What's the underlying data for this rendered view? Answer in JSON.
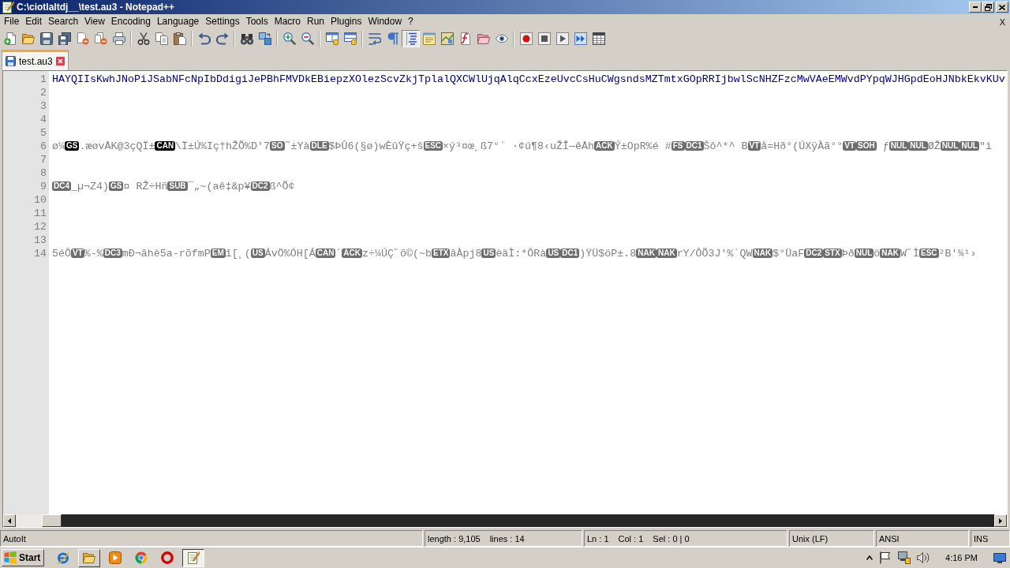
{
  "window": {
    "title": "C:\\ciotlaltdj__\\test.au3 - Notepad++"
  },
  "menu": {
    "items": [
      "File",
      "Edit",
      "Search",
      "View",
      "Encoding",
      "Language",
      "Settings",
      "Tools",
      "Macro",
      "Run",
      "Plugins",
      "Window",
      "?"
    ],
    "close_document": "X"
  },
  "toolbar": {
    "groups": [
      {
        "buttons": [
          {
            "kind": "new",
            "pressed": false
          },
          {
            "kind": "open",
            "pressed": false
          },
          {
            "kind": "save",
            "pressed": false
          },
          {
            "kind": "saveall",
            "pressed": false
          },
          {
            "kind": "close",
            "pressed": false
          },
          {
            "kind": "closeall",
            "pressed": false
          },
          {
            "kind": "print",
            "pressed": false
          }
        ]
      },
      {
        "buttons": [
          {
            "kind": "cut",
            "pressed": false
          },
          {
            "kind": "copy",
            "pressed": false
          },
          {
            "kind": "paste",
            "pressed": false
          }
        ]
      },
      {
        "buttons": [
          {
            "kind": "undo",
            "pressed": false
          },
          {
            "kind": "redo",
            "pressed": false
          }
        ]
      },
      {
        "buttons": [
          {
            "kind": "find",
            "pressed": false
          },
          {
            "kind": "replace",
            "pressed": false
          }
        ]
      },
      {
        "buttons": [
          {
            "kind": "zoomin",
            "pressed": false
          },
          {
            "kind": "zoomout",
            "pressed": false
          }
        ]
      },
      {
        "buttons": [
          {
            "kind": "syncv",
            "pressed": false
          },
          {
            "kind": "synch",
            "pressed": false
          }
        ]
      },
      {
        "buttons": [
          {
            "kind": "wrap",
            "pressed": false
          },
          {
            "kind": "pilcrow",
            "pressed": false
          },
          {
            "kind": "indent",
            "pressed": true
          },
          {
            "kind": "udl",
            "pressed": false
          },
          {
            "kind": "map",
            "pressed": false
          },
          {
            "kind": "functions",
            "pressed": false
          },
          {
            "kind": "workspace",
            "pressed": false
          },
          {
            "kind": "monitor",
            "pressed": false
          }
        ]
      },
      {
        "buttons": [
          {
            "kind": "record",
            "pressed": false
          },
          {
            "kind": "stop",
            "pressed": false
          },
          {
            "kind": "play",
            "pressed": false
          },
          {
            "kind": "repeat",
            "pressed": false
          },
          {
            "kind": "macros",
            "pressed": false
          }
        ]
      }
    ]
  },
  "tabs": [
    {
      "label": "test.au3",
      "selected": true
    }
  ],
  "editor": {
    "lines": [
      {
        "number": "1",
        "color": "#000080",
        "segments": [
          {
            "kind": "text",
            "text": "HAYQIIsKwhJNoPiJSabNFcNpIbDdigiJePBhFMVDkEBiepzXOlezScvZkjTplalQXCWlUjqAlqCcxEzeUvcCsHuCWgsndsMZTmtxGOpRRIjbwlScNHZFzcMwVAeEMWvdPYpqWJHGpdEoHJNbkEkvKUv"
          }
        ]
      },
      {
        "number": "2"
      },
      {
        "number": "3"
      },
      {
        "number": "4"
      },
      {
        "number": "5"
      },
      {
        "number": "6",
        "color": "#808080",
        "segments": [
          {
            "kind": "text",
            "text": "ø¼"
          },
          {
            "kind": "control",
            "text": "GS",
            "color": "#000000"
          },
          {
            "kind": "text",
            "text": ".æøvÅK@3çQÏ±"
          },
          {
            "kind": "control",
            "text": "CAN",
            "color": "#000000"
          },
          {
            "kind": "text",
            "text": "\\Ï±Ú%Iç†hŽÕ%D'7"
          },
          {
            "kind": "control",
            "text": "SO",
            "color": "#6e6e6e"
          },
          {
            "kind": "text",
            "text": "˜±Yà"
          },
          {
            "kind": "control",
            "text": "DLE",
            "color": "#6e6e6e"
          },
          {
            "kind": "text",
            "text": "$ÞÛ6(§ø)wÈûŸç+š"
          },
          {
            "kind": "control",
            "text": "ESC",
            "color": "#6e6e6e"
          },
          {
            "kind": "text",
            "text": "×ý³¤œ¸ß7°` ·¢ú¶8‹uŽÎ—êÅh"
          },
          {
            "kind": "control",
            "text": "ACK",
            "color": "#6e6e6e"
          },
          {
            "kind": "text",
            "text": "Ý±OpR%é #"
          },
          {
            "kind": "control",
            "text": "FS",
            "color": "#6e6e6e"
          },
          {
            "kind": "control",
            "text": "DC1",
            "color": "#6e6e6e"
          },
          {
            "kind": "text",
            "text": "Šô^*^ B"
          },
          {
            "kind": "control",
            "text": "VT",
            "color": "#6e6e6e"
          },
          {
            "kind": "text",
            "text": "å=Hð°(ÚXÿÀã°°"
          },
          {
            "kind": "control",
            "text": "VT",
            "color": "#6e6e6e"
          },
          {
            "kind": "control",
            "text": "SOH",
            "color": "#6e6e6e"
          },
          {
            "kind": "text",
            "text": " ƒ"
          },
          {
            "kind": "control",
            "text": "NUL",
            "color": "#6e6e6e"
          },
          {
            "kind": "control",
            "text": "NUL",
            "color": "#6e6e6e"
          },
          {
            "kind": "text",
            "text": "ØŽ"
          },
          {
            "kind": "control",
            "text": "NUL",
            "color": "#6e6e6e"
          },
          {
            "kind": "control",
            "text": "NUL",
            "color": "#6e6e6e"
          },
          {
            "kind": "text",
            "text": "\"ì"
          }
        ]
      },
      {
        "number": "7"
      },
      {
        "number": "8"
      },
      {
        "number": "9",
        "color": "#808080",
        "segments": [
          {
            "kind": "control",
            "text": "DC4",
            "color": "#6e6e6e"
          },
          {
            "kind": "text",
            "text": "_µ¬Z4)"
          },
          {
            "kind": "control",
            "text": "GS",
            "color": "#6e6e6e"
          },
          {
            "kind": "text",
            "text": "¤ RŽ÷Hñ"
          },
          {
            "kind": "control",
            "text": "SUB",
            "color": "#6e6e6e"
          },
          {
            "kind": "text",
            "text": "¯„~(aê‡&p¥"
          },
          {
            "kind": "control",
            "text": "DC2",
            "color": "#6e6e6e"
          },
          {
            "kind": "text",
            "text": "ß^Õ¢"
          }
        ]
      },
      {
        "number": "10"
      },
      {
        "number": "11"
      },
      {
        "number": "12"
      },
      {
        "number": "13"
      },
      {
        "number": "14",
        "color": "#808080",
        "segments": [
          {
            "kind": "text",
            "text": "5éÔ"
          },
          {
            "kind": "control",
            "text": "VT",
            "color": "#6e6e6e"
          },
          {
            "kind": "text",
            "text": "%-%"
          },
          {
            "kind": "control",
            "text": "DC3",
            "color": "#6e6e6e"
          },
          {
            "kind": "text",
            "text": "mÐ¬ãhè5a-rõfmP"
          },
          {
            "kind": "control",
            "text": "EM",
            "color": "#6e6e6e"
          },
          {
            "kind": "text",
            "text": "î[¸("
          },
          {
            "kind": "control",
            "text": "US",
            "color": "#6e6e6e"
          },
          {
            "kind": "text",
            "text": "ÁvÖ%ÓH[Á"
          },
          {
            "kind": "control",
            "text": "CAN",
            "color": "#6e6e6e"
          },
          {
            "kind": "text",
            "text": "´"
          },
          {
            "kind": "control",
            "text": "ACK",
            "color": "#6e6e6e"
          },
          {
            "kind": "text",
            "text": "z÷¼ÚÇ˝õ©(~b"
          },
          {
            "kind": "control",
            "text": "ETX",
            "color": "#6e6e6e"
          },
          {
            "kind": "text",
            "text": "âÀpj8"
          },
          {
            "kind": "control",
            "text": "US",
            "color": "#6e6e6e"
          },
          {
            "kind": "text",
            "text": "èäÌ:*ÔRà"
          },
          {
            "kind": "control",
            "text": "US",
            "color": "#6e6e6e"
          },
          {
            "kind": "control",
            "text": "DC1",
            "color": "#6e6e6e"
          },
          {
            "kind": "text",
            "text": ")ŸÜ$öP±.8"
          },
          {
            "kind": "control",
            "text": "NAK",
            "color": "#6e6e6e"
          },
          {
            "kind": "control",
            "text": "NAK",
            "color": "#6e6e6e"
          },
          {
            "kind": "text",
            "text": "rY/ÔÕ3J'%`QW"
          },
          {
            "kind": "control",
            "text": "NAK",
            "color": "#6e6e6e"
          },
          {
            "kind": "text",
            "text": "$°ÜaF"
          },
          {
            "kind": "control",
            "text": "DC2",
            "color": "#6e6e6e"
          },
          {
            "kind": "control",
            "text": "STX",
            "color": "#6e6e6e"
          },
          {
            "kind": "text",
            "text": "Þð"
          },
          {
            "kind": "control",
            "text": "NUL",
            "color": "#6e6e6e"
          },
          {
            "kind": "text",
            "text": "ö"
          },
          {
            "kind": "control",
            "text": "NAK",
            "color": "#6e6e6e"
          },
          {
            "kind": "text",
            "text": "W˝Ì"
          },
          {
            "kind": "control",
            "text": "ESC",
            "color": "#6e6e6e"
          },
          {
            "kind": "text",
            "text": "²B'¾¹›"
          }
        ]
      }
    ]
  },
  "status_bar": {
    "panels": [
      {
        "texts": [
          "AutoIt"
        ]
      },
      {
        "texts": [
          "length : 9,105",
          "lines : 14"
        ]
      },
      {
        "texts": [
          "Ln : 1",
          "Col : 1",
          "Sel : 0 | 0"
        ]
      },
      {
        "texts": [
          "Unix (LF)"
        ]
      },
      {
        "texts": [
          "ANSI"
        ]
      },
      {
        "texts": [
          "INS"
        ]
      }
    ]
  },
  "taskbar": {
    "start": "Start",
    "apps": [
      {
        "kind": "globe",
        "running": false,
        "selected": false
      },
      {
        "kind": "folder",
        "running": true,
        "selected": false
      },
      {
        "kind": "player",
        "running": false,
        "selected": false
      },
      {
        "kind": "wheel",
        "running": false,
        "selected": false
      },
      {
        "kind": "ring",
        "running": false,
        "selected": false
      },
      {
        "kind": "notepad",
        "running": true,
        "selected": true
      }
    ],
    "clock": "4:16 PM"
  }
}
